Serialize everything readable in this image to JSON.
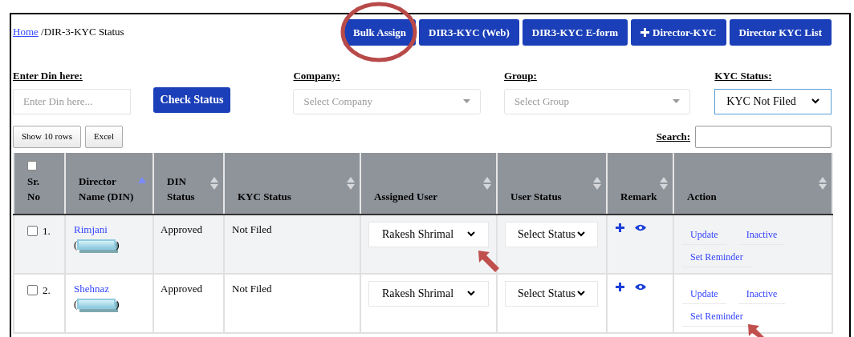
{
  "breadcrumb": {
    "link": "Home",
    "current": "/DIR-3-KYC Status"
  },
  "header_buttons": [
    {
      "label": "Bulk Assign",
      "kind": "text"
    },
    {
      "label": "DIR3-KYC (Web)",
      "kind": "text"
    },
    {
      "label": "DIR3-KYC E-form",
      "kind": "text"
    },
    {
      "label": "Director-KYC",
      "kind": "plus"
    },
    {
      "label": "Director KYC List",
      "kind": "text"
    }
  ],
  "filters": {
    "din": {
      "label": "Enter Din here:",
      "placeholder": "Enter Din here..."
    },
    "check_button": "Check Status",
    "company": {
      "label": "Company:",
      "placeholder": "Select Company"
    },
    "group": {
      "label": "Group:",
      "placeholder": "Select Group"
    },
    "kyc_status": {
      "label": "KYC Status:",
      "value": "KYC Not Filed"
    }
  },
  "table_buttons": [
    "Show 10 rows",
    "Excel"
  ],
  "search": {
    "label": "Search:"
  },
  "table": {
    "select_all_checked": false,
    "columns": [
      {
        "label": "Sr. No",
        "sortable": false
      },
      {
        "label": "Director Name (DIN)",
        "sortable": true,
        "sorted": true
      },
      {
        "label": "DIN Status",
        "sortable": true,
        "sorted": false
      },
      {
        "label": "KYC Status",
        "sortable": true,
        "sorted": false
      },
      {
        "label": "Assigned User",
        "sortable": true,
        "sorted": false
      },
      {
        "label": "User Status",
        "sortable": true,
        "sorted": false
      },
      {
        "label": "Remark",
        "sortable": true,
        "sorted": false
      },
      {
        "label": "Action",
        "sortable": true,
        "sorted": false
      }
    ],
    "rows": [
      {
        "checked": false,
        "sr": "1.",
        "name": "Rimjani",
        "din_open": "(",
        "din_close": ")",
        "din_status": "Approved",
        "kyc_status": "Not Filed",
        "assigned_user": "Rakesh Shrimal",
        "user_status": "Select Status",
        "actions": [
          "Update",
          "Inactive",
          "Set Reminder"
        ]
      },
      {
        "checked": false,
        "sr": "2.",
        "name": "Shehnaz",
        "din_open": "(",
        "din_close": ")",
        "din_status": "Approved",
        "kyc_status": "Not Filed",
        "assigned_user": "Rakesh Shrimal",
        "user_status": "Select Status",
        "actions": [
          "Update",
          "Inactive",
          "Set Reminder"
        ]
      }
    ]
  }
}
